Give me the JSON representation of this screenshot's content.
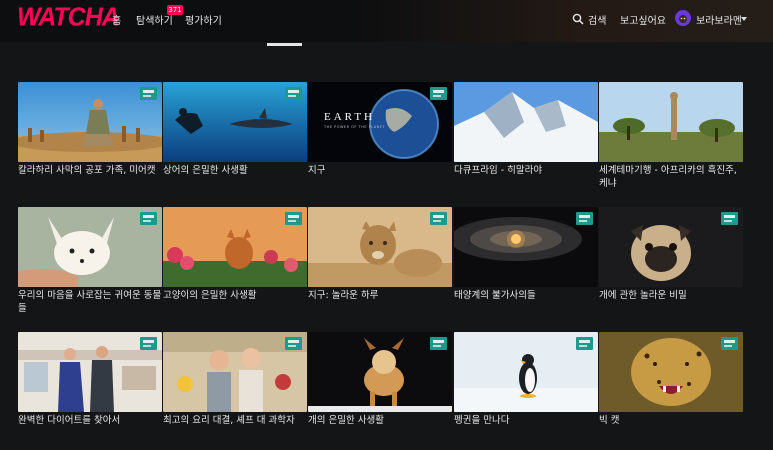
{
  "brand": {
    "logo_text": "WATCHA",
    "accent": "#ff0558"
  },
  "nav": {
    "home": "홈",
    "explore": "탐색하기",
    "explore_badge": "371",
    "rate": "평가하기",
    "search": "검색",
    "wishlist": "보고싶어요",
    "user": "보라보라멘"
  },
  "grid": [
    {
      "title": "칼라하리 사막의 공포 가족, 미어캣",
      "bbc": true
    },
    {
      "title": "상어의 은밀한 사생활",
      "bbc": true
    },
    {
      "title": "지구",
      "bbc": true,
      "poster_title": "EARTH",
      "poster_subtitle": "THE POWER OF THE PLANET"
    },
    {
      "title": "다큐프라임 - 히말라야",
      "bbc": false
    },
    {
      "title": "세계테마기행 - 아프리카의 흑진주, 케냐",
      "bbc": false
    },
    {
      "title": "우리의 마음을 사로잡는 귀여운 동물들",
      "bbc": true
    },
    {
      "title": "고양이의 은밀한 사생활",
      "bbc": true
    },
    {
      "title": "지구: 놀라운 하루",
      "bbc": true
    },
    {
      "title": "태양계의 불가사의들",
      "bbc": true
    },
    {
      "title": "개에 관한 놀라운 비밀",
      "bbc": true
    },
    {
      "title": "완벽한 다이어트를 찾아서",
      "bbc": true
    },
    {
      "title": "최고의 요리 대결, 셰프 대 과학자",
      "bbc": true
    },
    {
      "title": "개의 은밀한 사생활",
      "bbc": true
    },
    {
      "title": "펭귄을 만나다",
      "bbc": true
    },
    {
      "title": "빅 캣",
      "bbc": true
    }
  ]
}
